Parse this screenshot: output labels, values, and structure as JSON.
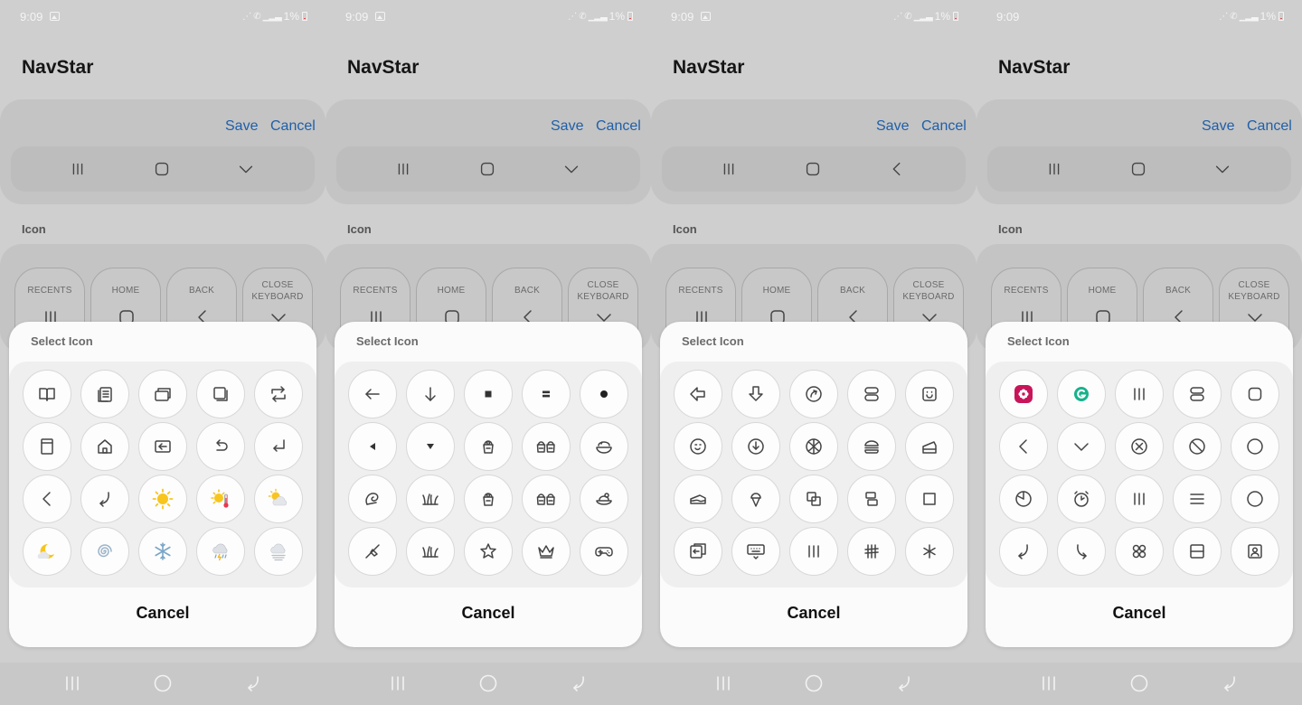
{
  "status": {
    "time": "9:09",
    "battery": "1%"
  },
  "app": {
    "title": "NavStar"
  },
  "preview": {
    "save": "Save",
    "cancel": "Cancel"
  },
  "section": {
    "icon_label": "Icon"
  },
  "nav_buttons": {
    "recents": "RECENTS",
    "home": "HOME",
    "back": "BACK",
    "close_keyboard_1": "CLOSE",
    "close_keyboard_2": "KEYBOARD"
  },
  "dialog": {
    "title": "Select Icon",
    "cancel": "Cancel"
  },
  "screens": [
    {
      "preview_icons": [
        "recents-lines-icon",
        "home-rounded-square-icon",
        "chevron-down-icon"
      ],
      "grid_icons": [
        "book-icon",
        "document-stack-icon",
        "window-stack-icon",
        "copy-square-icon",
        "repeat-icon",
        "page-icon",
        "house-icon",
        "exit-arrow-icon",
        "undo-icon",
        "return-arrow-icon",
        "chevron-left-icon",
        "curved-back-arrow-icon",
        "sun-icon",
        "hot-sun-thermometer-icon",
        "sun-behind-cloud-icon",
        "crescent-moon-cloud-icon",
        "spiral-icon",
        "snowflake-icon",
        "thunder-rain-cloud-icon",
        "fog-cloud-icon"
      ]
    },
    {
      "preview_icons": [
        "recents-lines-icon",
        "home-rounded-square-icon",
        "chevron-down-icon"
      ],
      "grid_icons": [
        "arrow-left-icon",
        "arrow-down-icon",
        "small-square-icon",
        "equals-block-icon",
        "dot-icon",
        "triangle-left-icon",
        "triangle-down-icon",
        "takeout-food-icon",
        "double-takeout-food-icon",
        "bowl-icon",
        "spiral-shell-icon",
        "grass-icon",
        "takeout-food-icon",
        "double-takeout-food-icon",
        "dish-icon",
        "shovel-icon",
        "grass-icon",
        "star-icon",
        "crown-icon",
        "gamepad-icon"
      ]
    },
    {
      "preview_icons": [
        "recents-lines-icon",
        "home-rounded-square-icon",
        "chevron-left-icon"
      ],
      "grid_icons": [
        "pointer-left-icon",
        "pointer-down-icon",
        "circle-arrow-icon",
        "pill-rounded-icon",
        "smile-square-icon",
        "wink-circle-icon",
        "clock-down-icon",
        "ball-icon",
        "burger-icon",
        "cake-icon",
        "cake-slice-icon",
        "ice-cream-icon",
        "overlap-squares-icon",
        "stacked-boxes-icon",
        "square-outline-icon",
        "window-exit-icon",
        "keyboard-down-icon",
        "recents-lines-icon",
        "hash-lines-icon",
        "asterisk-icon"
      ]
    },
    {
      "preview_icons": [
        "recents-lines-icon",
        "home-rounded-square-icon",
        "chevron-down-icon"
      ],
      "grid_icons": [
        "flower-app-icon",
        "grammarly-app-icon",
        "recents-lines-icon",
        "double-pill-icon",
        "rounded-square-icon",
        "chevron-left-icon",
        "chevron-down-icon",
        "cross-circle-icon",
        "prohibited-icon",
        "circle-icon",
        "pie-clock-icon",
        "alarm-clock-icon",
        "recents-lines-icon",
        "hamburger-menu-icon",
        "circle-icon",
        "curved-back-arrow-icon",
        "curved-forward-arrow-icon",
        "four-dots-icon",
        "split-square-icon",
        "portrait-frame-icon"
      ]
    }
  ],
  "system_nav": [
    "recents-icon",
    "home-icon",
    "back-icon"
  ],
  "colors": {
    "link": "#1f5fa8",
    "sun": "#f7c51e",
    "flower_app": "#c8155a",
    "grammarly_app": "#17b28c"
  }
}
